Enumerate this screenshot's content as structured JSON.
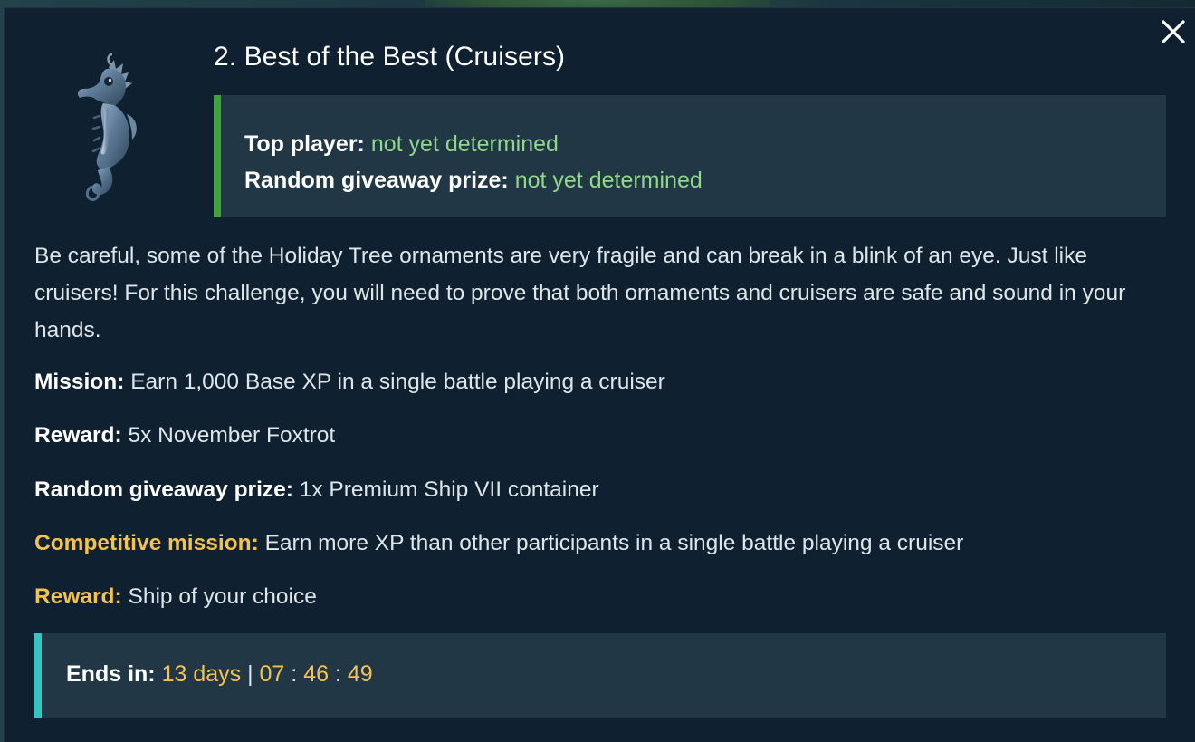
{
  "modal": {
    "title": "2. Best of the Best (Cruisers)",
    "close_icon": "close-icon",
    "image_icon": "seahorse-ornament-icon"
  },
  "status": {
    "top_player_label": "Top player:",
    "top_player_value": "not yet determined",
    "giveaway_label": "Random giveaway prize:",
    "giveaway_value": "not yet determined",
    "accent_color": "#3fa33a",
    "value_color": "#8fd88a"
  },
  "description": "Be careful, some of the Holiday Tree ornaments are very fragile and can break in a blink of an eye. Just like cruisers! For this challenge, you will need to prove that both ornaments and cruisers are safe and sound in your hands.",
  "details": {
    "mission_label": "Mission:",
    "mission_value": "Earn 1,000 Base XP in a single battle playing a cruiser",
    "reward_label": "Reward:",
    "reward_value": "5x November Foxtrot",
    "giveaway_label": "Random giveaway prize:",
    "giveaway_value": "1x Premium Ship VII container",
    "competitive_label": "Competitive mission:",
    "competitive_value": "Earn more XP than other participants in a single battle playing a cruiser",
    "competitive_reward_label": "Reward:",
    "competitive_reward_value": "Ship of your choice",
    "highlight_color": "#f5c24d"
  },
  "timer": {
    "label": "Ends in:",
    "days": "13 days",
    "divider": "|",
    "hours": "07",
    "minutes": "46",
    "seconds": "49",
    "colon": ":",
    "accent_color": "#35c4c4"
  }
}
